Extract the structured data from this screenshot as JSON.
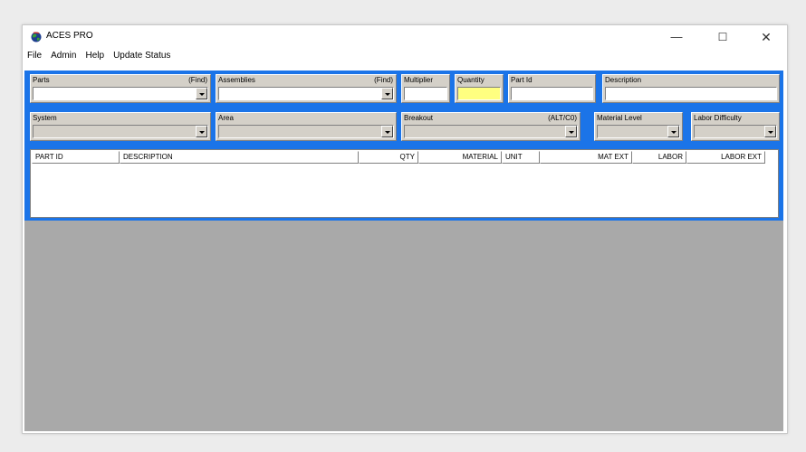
{
  "window": {
    "title": "ACES PRO",
    "minimize_glyph": "—",
    "maximize_glyph": "☐",
    "close_glyph": "✕"
  },
  "menu": [
    "File",
    "Admin",
    "Help",
    "Update Status"
  ],
  "fields": {
    "parts": {
      "label": "Parts",
      "find": "(Find)",
      "value": ""
    },
    "assemblies": {
      "label": "Assemblies",
      "find": "(Find)",
      "value": ""
    },
    "multiplier": {
      "label": "Multiplier",
      "value": ""
    },
    "quantity": {
      "label": "Quantity",
      "value": ""
    },
    "part_id": {
      "label": "Part Id",
      "value": ""
    },
    "description": {
      "label": "Description",
      "value": ""
    },
    "system": {
      "label": "System",
      "value": ""
    },
    "area": {
      "label": "Area",
      "value": ""
    },
    "breakout": {
      "label": "Breakout",
      "shortcut": "(ALT/C0)",
      "value": ""
    },
    "material_level": {
      "label": "Material Level",
      "value": ""
    },
    "labor_difficulty": {
      "label": "Labor Difficulty",
      "value": ""
    }
  },
  "grid": {
    "columns": [
      "PART ID",
      "DESCRIPTION",
      "QTY",
      "MATERIAL",
      "UNIT",
      "MAT EXT",
      "LABOR",
      "LABOR EXT"
    ],
    "rows": []
  },
  "colors": {
    "panel_blue": "#1b74e8",
    "quantity_highlight": "#ffff80",
    "empty_area": "#a9a9a9"
  },
  "icons": {
    "app": "globe-icon",
    "dropdown": "chevron-down-icon"
  }
}
